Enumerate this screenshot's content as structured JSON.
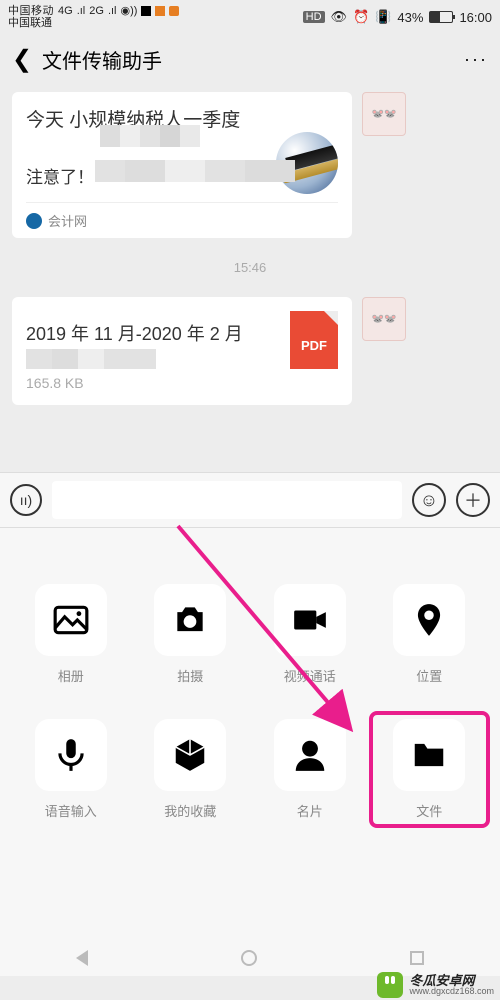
{
  "status": {
    "carrier1": "中国移动",
    "carrier2": "中国联通",
    "net": "4G",
    "net2": "2G",
    "hd": "HD",
    "battery_pct": "43%",
    "time": "16:00"
  },
  "header": {
    "title": "文件传输助手",
    "more": "···"
  },
  "msg1": {
    "line1": "今天           小规模纳税人一季度",
    "line2": "注意了！",
    "source": "会计网"
  },
  "divider_time": "15:46",
  "msg2": {
    "title": "2019 年 11 月-2020 年 2 月",
    "pdf_label": "PDF",
    "size": "165.8 KB"
  },
  "panel": {
    "items": [
      {
        "label": "相册"
      },
      {
        "label": "拍摄"
      },
      {
        "label": "视频通话"
      },
      {
        "label": "位置"
      },
      {
        "label": "语音输入"
      },
      {
        "label": "我的收藏"
      },
      {
        "label": "名片"
      },
      {
        "label": "文件"
      }
    ]
  },
  "watermark": {
    "cn": "冬瓜安卓网",
    "url": "www.dgxcdz168.com"
  }
}
